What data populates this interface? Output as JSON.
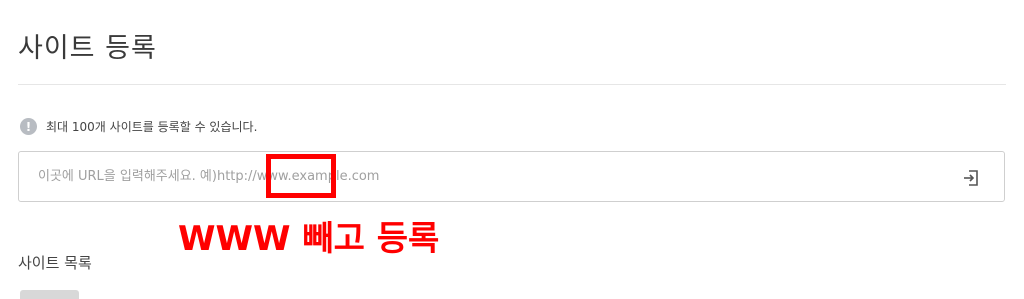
{
  "page": {
    "title": "사이트 등록"
  },
  "notice": {
    "icon": "info-icon",
    "icon_glyph": "!",
    "text": "최대 100개 사이트를 등록할 수 있습니다."
  },
  "url_field": {
    "placeholder": "이곳에 URL을 입력해주세요. 예)http://www.example.com",
    "value": "",
    "submit_icon": "enter-icon"
  },
  "annotation": {
    "text": "WWW 빼고 등록",
    "color": "#ff0000"
  },
  "site_list": {
    "title": "사이트 목록"
  }
}
